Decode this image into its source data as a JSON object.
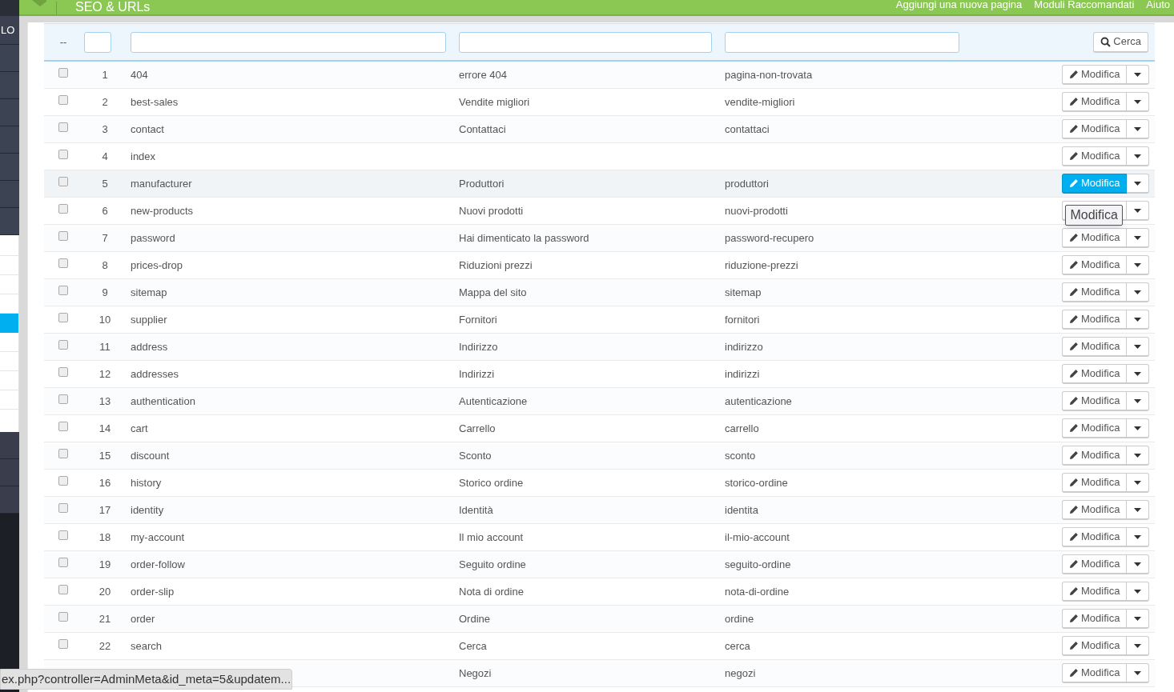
{
  "header": {
    "title": "SEO & URLs",
    "links": [
      "Aggiungi una nuova pagina",
      "Moduli Raccomandati",
      "Aiuto"
    ]
  },
  "sidebar": {
    "label": "LO",
    "submenu": [
      {
        "selected": false
      },
      {
        "selected": false
      },
      {
        "selected": false
      },
      {
        "selected": false
      },
      {
        "selected": true
      },
      {
        "selected": false
      },
      {
        "selected": false
      },
      {
        "selected": false
      },
      {
        "selected": false
      }
    ]
  },
  "filters": {
    "bulk": "--",
    "search_button": "Cerca"
  },
  "rows": [
    {
      "checked": false,
      "id": "1",
      "page": "404",
      "title": "errore 404",
      "url": "pagina-non-trovata",
      "action": "Modifica",
      "hovered": false
    },
    {
      "checked": false,
      "id": "2",
      "page": "best-sales",
      "title": "Vendite migliori",
      "url": "vendite-migliori",
      "action": "Modifica",
      "hovered": false
    },
    {
      "checked": false,
      "id": "3",
      "page": "contact",
      "title": "Contattaci",
      "url": "contattaci",
      "action": "Modifica",
      "hovered": false
    },
    {
      "checked": false,
      "id": "4",
      "page": "index",
      "action": "Modifica",
      "hovered": false
    },
    {
      "checked": false,
      "id": "5",
      "page": "manufacturer",
      "title": "Produttori",
      "url": "produttori",
      "action": "Modifica",
      "hovered": true
    },
    {
      "checked": false,
      "id": "6",
      "page": "new-products",
      "title": "Nuovi prodotti",
      "url": "nuovi-prodotti",
      "tooltip": "Modifica",
      "hovered": false
    },
    {
      "checked": false,
      "id": "7",
      "page": "password",
      "title": "Hai dimenticato la password",
      "url": "password-recupero",
      "action": "Modifica",
      "hovered": false
    },
    {
      "checked": false,
      "id": "8",
      "page": "prices-drop",
      "title": "Riduzioni prezzi",
      "url": "riduzione-prezzi",
      "action": "Modifica",
      "hovered": false
    },
    {
      "checked": false,
      "id": "9",
      "page": "sitemap",
      "title": "Mappa del sito",
      "url": "sitemap",
      "action": "Modifica",
      "hovered": false
    },
    {
      "checked": false,
      "id": "10",
      "page": "supplier",
      "title": "Fornitori",
      "url": "fornitori",
      "action": "Modifica",
      "hovered": false
    },
    {
      "checked": false,
      "id": "11",
      "page": "address",
      "title": "Indirizzo",
      "url": "indirizzo",
      "action": "Modifica",
      "hovered": false
    },
    {
      "checked": false,
      "id": "12",
      "page": "addresses",
      "title": "Indirizzi",
      "url": "indirizzi",
      "action": "Modifica",
      "hovered": false
    },
    {
      "checked": false,
      "id": "13",
      "page": "authentication",
      "title": "Autenticazione",
      "url": "autenticazione",
      "action": "Modifica",
      "hovered": false
    },
    {
      "checked": false,
      "id": "14",
      "page": "cart",
      "title": "Carrello",
      "url": "carrello",
      "action": "Modifica",
      "hovered": false
    },
    {
      "checked": false,
      "id": "15",
      "page": "discount",
      "title": "Sconto",
      "url": "sconto",
      "action": "Modifica",
      "hovered": false
    },
    {
      "checked": false,
      "id": "16",
      "page": "history",
      "title": "Storico ordine",
      "url": "storico-ordine",
      "action": "Modifica",
      "hovered": false
    },
    {
      "checked": false,
      "id": "17",
      "page": "identity",
      "title": "Identità",
      "url": "identita",
      "action": "Modifica",
      "hovered": false
    },
    {
      "checked": false,
      "id": "18",
      "page": "my-account",
      "title": "Il mio account",
      "url": "il-mio-account",
      "action": "Modifica",
      "hovered": false
    },
    {
      "checked": false,
      "id": "19",
      "page": "order-follow",
      "title": "Seguito ordine",
      "url": "seguito-ordine",
      "action": "Modifica",
      "hovered": false
    },
    {
      "checked": false,
      "id": "20",
      "page": "order-slip",
      "title": "Nota di ordine",
      "url": "nota-di-ordine",
      "action": "Modifica",
      "hovered": false
    },
    {
      "checked": false,
      "id": "21",
      "page": "order",
      "title": "Ordine",
      "url": "ordine",
      "action": "Modifica",
      "hovered": false
    },
    {
      "checked": false,
      "id": "22",
      "page": "search",
      "title": "Cerca",
      "url": "cerca",
      "action": "Modifica",
      "hovered": false
    },
    {
      "title": "Negozi",
      "url": "negozi",
      "action": "Modifica",
      "hovered": false
    }
  ],
  "status_bar": {
    "url": "ex.php?controller=AdminMeta&id_meta=5&updatem..."
  }
}
